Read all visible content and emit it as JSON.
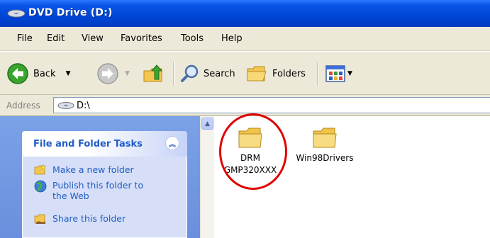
{
  "window": {
    "title": "DVD Drive (D:)"
  },
  "menubar": {
    "items": [
      "File",
      "Edit",
      "View",
      "Favorites",
      "Tools",
      "Help"
    ]
  },
  "toolbar": {
    "back_label": "Back",
    "search_label": "Search",
    "folders_label": "Folders"
  },
  "address": {
    "label": "Address",
    "value": "D:\\"
  },
  "tasks_panel": {
    "title": "File and Folder Tasks",
    "items": [
      {
        "label": "Make a new folder",
        "icon": "new-folder-icon"
      },
      {
        "label": "Publish this folder to the Web",
        "icon": "publish-web-icon"
      },
      {
        "label": "Share this folder",
        "icon": "share-folder-icon"
      }
    ]
  },
  "files": [
    {
      "name_line1": "DRM",
      "name_line2": "GMP320XXX",
      "icon": "folder-icon",
      "highlighted": true
    },
    {
      "name_line1": "Win98Drivers",
      "name_line2": "",
      "icon": "folder-icon",
      "highlighted": false
    }
  ],
  "colors": {
    "title_bar": "#0047d8",
    "task_link": "#215dc6",
    "highlight_circle": "#e10000"
  }
}
